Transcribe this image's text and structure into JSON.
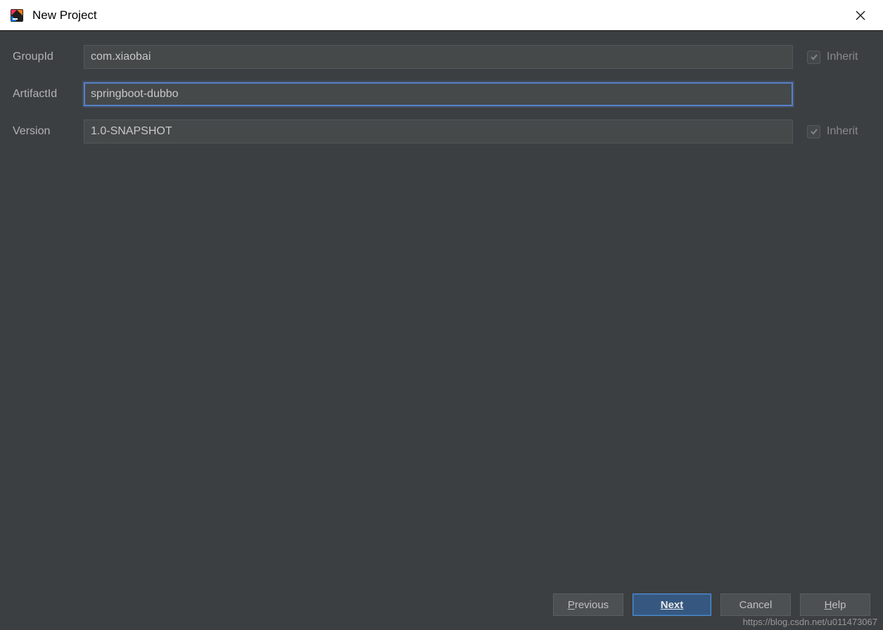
{
  "window": {
    "title": "New Project"
  },
  "form": {
    "groupId": {
      "label": "GroupId",
      "value": "com.xiaobai",
      "inherit_label": "Inherit",
      "inherit_checked": true
    },
    "artifactId": {
      "label": "ArtifactId",
      "value": "springboot-dubbo"
    },
    "version": {
      "label": "Version",
      "value": "1.0-SNAPSHOT",
      "inherit_label": "Inherit",
      "inherit_checked": true
    }
  },
  "buttons": {
    "previous": {
      "mnemonic": "P",
      "rest": "revious"
    },
    "next": {
      "label": "Next"
    },
    "cancel": {
      "label": "Cancel"
    },
    "help": {
      "mnemonic": "H",
      "rest": "elp"
    }
  },
  "watermark": "https://blog.csdn.net/u011473067"
}
